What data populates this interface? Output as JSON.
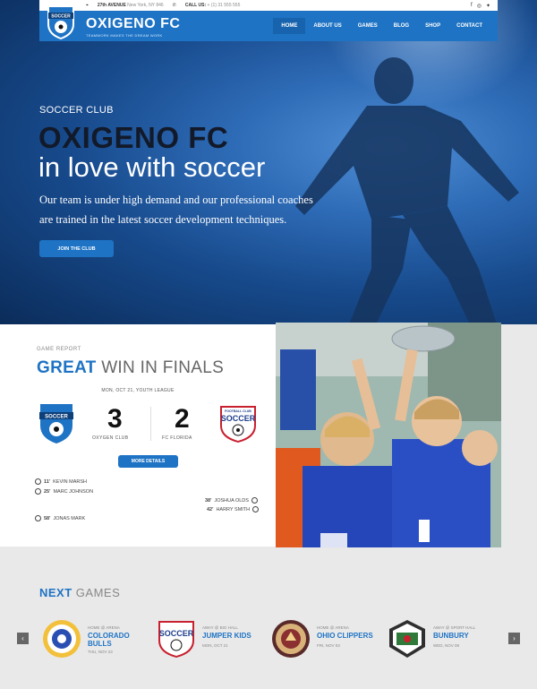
{
  "topbar": {
    "address_bold": "27th AVENUE",
    "address_rest": "New York, NY 846",
    "call_label": "CALL US:",
    "phone": "+ (1) 31 555 555",
    "social_icons": [
      "facebook-icon",
      "instagram-icon",
      "twitter-icon"
    ]
  },
  "brand": {
    "name": "OXIGENO FC",
    "tagline": "TEAMWORK MAKES THE DREAM WORK",
    "logo_text": "SOCCER"
  },
  "menu": {
    "items": [
      "HOME",
      "ABOUT US",
      "GAMES",
      "BLOG",
      "SHOP",
      "CONTACT"
    ],
    "active": "HOME"
  },
  "hero": {
    "kicker": "SOCCER CLUB",
    "title": "OXIGENO FC",
    "subtitle": "in love with soccer",
    "desc_line1": "Our team is under high demand and our professional coaches",
    "desc_line2": "are trained in the latest soccer development techniques.",
    "cta": "JOIN THE CLUB"
  },
  "report": {
    "kicker": "GAME REPORT",
    "title_bold": "GREAT",
    "title_rest": "WIN IN FINALS",
    "meta": "MON, OCT 21, YOUTH LEAGUE",
    "home_team": "OXYGEN CLUB",
    "away_team": "FC FLORIDA",
    "home_score": "3",
    "away_score": "2",
    "away_logo_top": "FOOTBALL CLUB",
    "away_logo_text": "SOCCER",
    "details_button": "MORE DETAILS",
    "scorers_home": [
      {
        "minute": "11'",
        "name": "KEVIN MARSH"
      },
      {
        "minute": "25'",
        "name": "MARC JOHNSON"
      },
      {
        "minute": "58'",
        "name": "JONAS MARK"
      }
    ],
    "scorers_away": [
      {
        "minute": "38'",
        "name": "JOSHUA OLDS"
      },
      {
        "minute": "42'",
        "name": "HARRY SMITH"
      }
    ]
  },
  "next": {
    "title_bold": "NEXT",
    "title_rest": "GAMES",
    "games": [
      {
        "venue": "HOME @ ARENA",
        "team_line1": "COLORADO",
        "team_line2": "BULLS",
        "date": "THU, NOV 23"
      },
      {
        "venue": "AWAY @ BIG HALL",
        "team_line1": "JUMPER KIDS",
        "team_line2": "",
        "date": "MON, OCT 21"
      },
      {
        "venue": "HOME @ ARENA",
        "team_line1": "OHIO CLIPPERS",
        "team_line2": "",
        "date": "FRI, NOV 03"
      },
      {
        "venue": "AWAY @ SPORT HALL",
        "team_line1": "BUNBURY",
        "team_line2": "",
        "date": "WED, NOV 08"
      }
    ]
  },
  "colors": {
    "accent": "#1e73c4",
    "dark": "#121a2a"
  }
}
